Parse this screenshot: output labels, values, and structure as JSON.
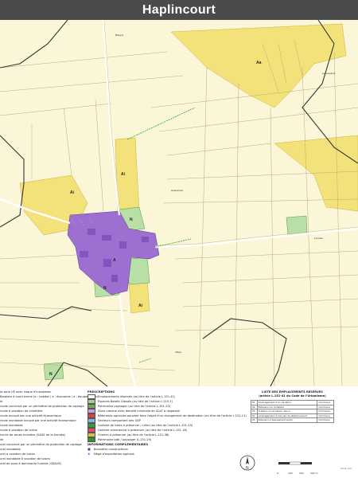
{
  "header": {
    "title": "Haplincourt"
  },
  "map": {
    "zone_labels": {
      "aa": "Aa",
      "ai_left": "Ai",
      "ai_center": "Ai",
      "ai_lower": "Ai",
      "n1": "N",
      "n2": "N",
      "n3": "N",
      "a": "A"
    },
    "place_names": {
      "top": "Bangny",
      "top_right": "Lebucquière",
      "center": "Haplincourt",
      "right": "La Folie",
      "lower": "Villers"
    },
    "colors": {
      "background": "#fbf6d8",
      "agri_yellow": "#f3e27a",
      "urban_purple": "#9d6fd0",
      "natural_green": "#b7dfa6",
      "boundary": "#333333",
      "road": "#ffffff"
    }
  },
  "legend": {
    "col1": [
      "la zone UE avec risque d'inondation",
      "Baraiere à court terme (a : habitat / e : économie / d : équipements)",
      "le",
      "ricole concerné par un périmètre de protection de captage",
      "ricole à vocation de cimetière",
      "ricole occupé par une activité économique",
      "ricole inondable occupé par une activité économique",
      "ricole inondable",
      "ricole à vocation de loisirs",
      "ircicle de zones humides (SAGE de la Sensée)",
      "ile",
      "urel concerné par un périmètre de protection de captage",
      "urel inondable",
      "urel à vocation de loisirs",
      "urel inondable à vocation de loisirs",
      "urel de zone à dominante humide (SDAGE)"
    ],
    "prescriptions_title": "PRESCRIPTIONS",
    "prescriptions": [
      "Emplacements réservés (au titre de l'article L.151-41)",
      "Espaces Boisés Classés (au titre de l'article L.113-1)",
      "Patrimoine paysager (au titre de l'article L.151-23)",
      "Zone urbaine avec densité minimale de SCoT à respecter",
      "Bâtiments agricoles pouvant faire l'objet d'un changement de destination (au titre de l'article L.151-11)",
      "Secteurs comportant des OAP",
      "Linéaire de haies à préserver / créer (au titre de l'article L.151-23)",
      "Linéaire commercial à préserver (au titre de l'article L.151-16)",
      "Chemin à préserver (au titre de l'article L.151-38)",
      "Patrimoine bâti / paysager (L.151-19)"
    ],
    "info_title": "INFORMATIONS COMPLEMENTAIRES",
    "info": [
      "Nouvelles constructions",
      "Siège d'exploitation agricole"
    ],
    "swatch_colors": [
      "#ffffff",
      "#9fd38a",
      "#6ab04c",
      "#c9a0e0",
      "#e04040",
      "#7db7e8",
      "#3a9a3a",
      "#e05050",
      "#d8c050",
      "#2a9a2a"
    ]
  },
  "reserved_table": {
    "title": "LISTE DES EMPLACEMENTS RESERVES",
    "subtitle": "(article L.151-41 du Code de l'Urbanisme)",
    "rows": [
      [
        "01",
        "Aménagement d'un carrefour",
        "Commune"
      ],
      [
        "02",
        "Extension du cimetière",
        "Commune"
      ],
      [
        "03",
        "Création d'une liaison douce",
        "Commune"
      ],
      [
        "04",
        "Aménagement d'une aire de stationnement",
        "Commune"
      ],
      [
        "05",
        "Extension d'équipement public",
        "Commune"
      ]
    ]
  },
  "scale": {
    "ticks": [
      "0",
      "100",
      "200",
      "300 m"
    ]
  },
  "credit": "Fond cad."
}
